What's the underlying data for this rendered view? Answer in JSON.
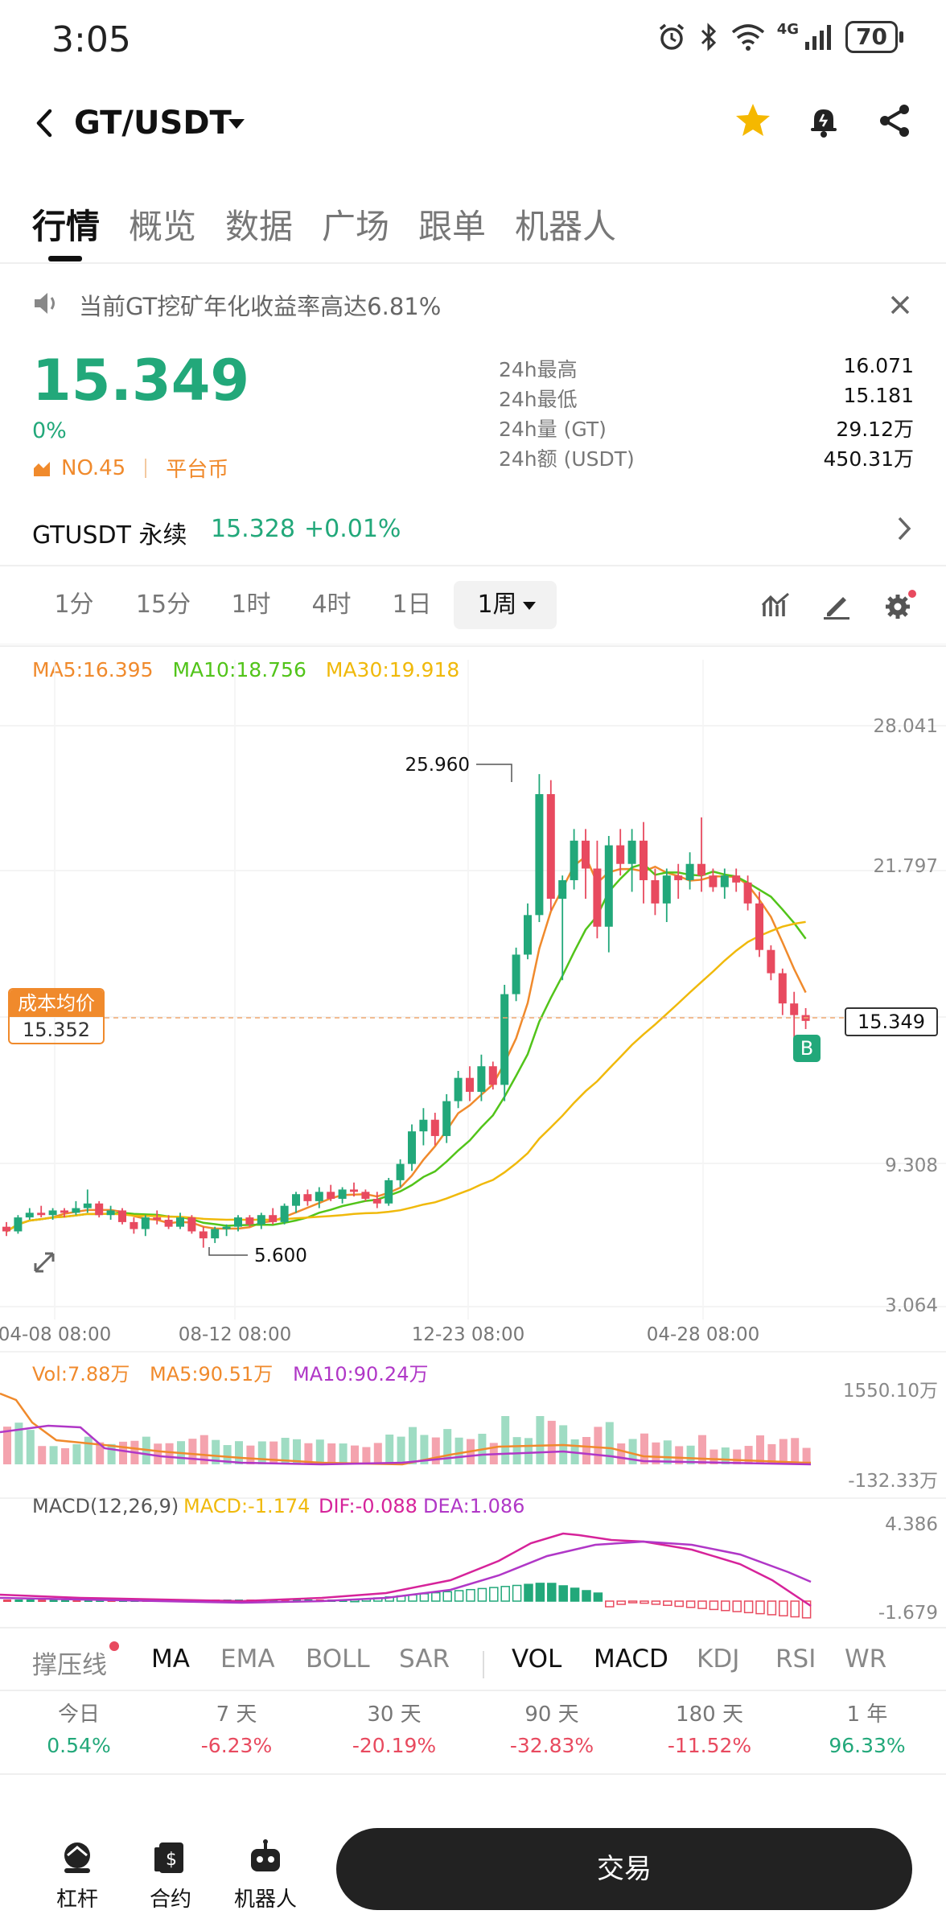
{
  "status_bar": {
    "time": "3:05",
    "network": "4G",
    "battery": "70"
  },
  "header": {
    "pair": "GT/USDT",
    "icons": [
      "back-icon",
      "star-icon",
      "bell-icon",
      "share-icon"
    ]
  },
  "tabs": [
    "行情",
    "概览",
    "数据",
    "广场",
    "跟单",
    "机器人"
  ],
  "notice": {
    "text": "当前GT挖矿年化收益率高达6.81%"
  },
  "ticker": {
    "price": "15.349",
    "change_pct": "0%",
    "rank": "NO.45",
    "category": "平台币",
    "stats": [
      {
        "label": "24h最高",
        "value": "16.071"
      },
      {
        "label": "24h最低",
        "value": "15.181"
      },
      {
        "label": "24h量 (GT)",
        "value": "29.12万"
      },
      {
        "label": "24h额 (USDT)",
        "value": "450.31万"
      }
    ]
  },
  "perpetual": {
    "name": "GTUSDT 永续",
    "price": "15.328",
    "change": "+0.01%"
  },
  "timeframes": [
    "1分",
    "15分",
    "1时",
    "4时",
    "1日",
    "1周"
  ],
  "active_timeframe": "1周",
  "ma_legend": {
    "ma5": "MA5:16.395",
    "ma10": "MA10:18.756",
    "ma30": "MA30:19.918"
  },
  "colors": {
    "up": "#22a87a",
    "down": "#e84a5f",
    "ma5": "#f08a2c",
    "ma10": "#52c41a",
    "ma30": "#f0b90b",
    "purple": "#b037c7",
    "magenta": "#d6239a"
  },
  "price_axis": [
    "28.041",
    "21.797",
    "9.308",
    "3.064"
  ],
  "date_axis": [
    "04-08 08:00",
    "08-12 08:00",
    "12-23 08:00",
    "04-28 08:00"
  ],
  "annotations": {
    "high": "25.960",
    "low": "5.600"
  },
  "cost_basis": {
    "label": "成本均价",
    "value": "15.352"
  },
  "last_price_tag": "15.349",
  "buy_marker": "B",
  "vol_legend": {
    "vol": "Vol:7.88万",
    "ma5": "MA5:90.51万",
    "ma10": "MA10:90.24万"
  },
  "vol_axis": [
    "1550.10万",
    "-132.33万"
  ],
  "macd_legend": {
    "name": "MACD(12,26,9)",
    "macd": "MACD:-1.174",
    "dif": "DIF:-0.088",
    "dea": "DEA:1.086"
  },
  "macd_axis": [
    "4.386",
    "-1.679"
  ],
  "indicator_tabs": [
    "撑压线",
    "MA",
    "EMA",
    "BOLL",
    "SAR",
    "VOL",
    "MACD",
    "KDJ",
    "RSI",
    "WR"
  ],
  "performance": [
    {
      "label": "今日",
      "value": "0.54%"
    },
    {
      "label": "7 天",
      "value": "-6.23%"
    },
    {
      "label": "30 天",
      "value": "-20.19%"
    },
    {
      "label": "90 天",
      "value": "-32.83%"
    },
    {
      "label": "180 天",
      "value": "-11.52%"
    },
    {
      "label": "1 年",
      "value": "96.33%"
    }
  ],
  "bottom_nav": [
    "杠杆",
    "合约",
    "机器人"
  ],
  "trade_button": "交易",
  "chart_data": {
    "type": "candlestick",
    "interval": "1周",
    "y_range": [
      3.064,
      28.041
    ],
    "candles": [
      [
        6.5,
        6.7,
        6.1,
        6.3
      ],
      [
        6.3,
        7.0,
        6.2,
        6.9
      ],
      [
        6.9,
        7.3,
        6.8,
        7.1
      ],
      [
        7.1,
        7.4,
        6.9,
        7.0
      ],
      [
        7.0,
        7.3,
        6.8,
        7.2
      ],
      [
        7.2,
        7.3,
        6.9,
        7.1
      ],
      [
        7.1,
        7.6,
        7.0,
        7.3
      ],
      [
        7.3,
        8.1,
        7.1,
        7.5
      ],
      [
        7.5,
        7.6,
        6.9,
        7.0
      ],
      [
        7.0,
        7.4,
        6.8,
        7.2
      ],
      [
        7.2,
        7.3,
        6.6,
        6.7
      ],
      [
        6.7,
        6.9,
        6.2,
        6.4
      ],
      [
        6.4,
        7.0,
        6.1,
        6.9
      ],
      [
        6.9,
        7.2,
        6.6,
        6.8
      ],
      [
        6.8,
        7.0,
        6.4,
        6.5
      ],
      [
        6.5,
        7.1,
        6.4,
        6.9
      ],
      [
        6.9,
        7.0,
        6.2,
        6.3
      ],
      [
        6.3,
        6.5,
        5.6,
        6.0
      ],
      [
        6.0,
        6.5,
        5.8,
        6.4
      ],
      [
        6.4,
        6.6,
        6.1,
        6.5
      ],
      [
        6.5,
        7.0,
        6.3,
        6.9
      ],
      [
        6.9,
        7.0,
        6.5,
        6.6
      ],
      [
        6.6,
        7.1,
        6.4,
        7.0
      ],
      [
        7.0,
        7.3,
        6.6,
        6.7
      ],
      [
        6.7,
        7.5,
        6.6,
        7.4
      ],
      [
        7.4,
        8.0,
        7.1,
        7.9
      ],
      [
        7.9,
        8.1,
        7.4,
        7.6
      ],
      [
        7.6,
        8.2,
        7.3,
        8.0
      ],
      [
        8.0,
        8.3,
        7.6,
        7.7
      ],
      [
        7.7,
        8.2,
        7.5,
        8.1
      ],
      [
        8.1,
        8.4,
        7.8,
        8.0
      ],
      [
        8.0,
        8.1,
        7.6,
        7.7
      ],
      [
        7.7,
        8.0,
        7.3,
        7.5
      ],
      [
        7.5,
        8.6,
        7.4,
        8.5
      ],
      [
        8.5,
        9.4,
        8.2,
        9.2
      ],
      [
        9.2,
        10.9,
        8.9,
        10.6
      ],
      [
        10.6,
        11.6,
        10.0,
        11.1
      ],
      [
        11.1,
        11.4,
        10.0,
        10.4
      ],
      [
        10.4,
        12.2,
        10.1,
        11.9
      ],
      [
        11.9,
        13.2,
        11.6,
        12.9
      ],
      [
        12.9,
        13.4,
        11.9,
        12.3
      ],
      [
        12.3,
        13.9,
        11.9,
        13.4
      ],
      [
        13.4,
        13.6,
        12.4,
        12.6
      ],
      [
        12.6,
        16.9,
        11.9,
        16.5
      ],
      [
        16.5,
        18.5,
        16.2,
        18.2
      ],
      [
        18.2,
        20.4,
        18.0,
        19.9
      ],
      [
        19.9,
        25.96,
        19.6,
        25.1
      ],
      [
        25.1,
        25.7,
        20.1,
        20.6
      ],
      [
        20.6,
        21.6,
        17.1,
        21.4
      ],
      [
        21.4,
        23.6,
        21.0,
        23.1
      ],
      [
        23.1,
        23.6,
        20.6,
        21.9
      ],
      [
        21.9,
        23.1,
        18.9,
        19.4
      ],
      [
        19.4,
        23.3,
        18.3,
        22.9
      ],
      [
        22.9,
        23.6,
        21.6,
        22.1
      ],
      [
        22.1,
        23.6,
        20.9,
        23.1
      ],
      [
        23.1,
        23.9,
        20.4,
        21.4
      ],
      [
        21.4,
        21.9,
        19.9,
        20.4
      ],
      [
        20.4,
        21.9,
        19.6,
        21.6
      ],
      [
        21.6,
        22.1,
        20.6,
        21.4
      ],
      [
        21.4,
        22.6,
        21.0,
        22.1
      ],
      [
        22.1,
        24.1,
        20.9,
        21.6
      ],
      [
        21.6,
        21.9,
        20.9,
        21.1
      ],
      [
        21.1,
        21.9,
        20.6,
        21.6
      ],
      [
        21.6,
        21.9,
        20.9,
        21.3
      ],
      [
        21.3,
        21.6,
        20.1,
        20.4
      ],
      [
        20.4,
        20.9,
        18.1,
        18.4
      ],
      [
        18.4,
        18.6,
        17.1,
        17.4
      ],
      [
        17.4,
        17.6,
        15.6,
        16.1
      ],
      [
        16.1,
        16.6,
        14.6,
        15.6
      ],
      [
        15.6,
        15.9,
        15.0,
        15.35
      ]
    ]
  }
}
